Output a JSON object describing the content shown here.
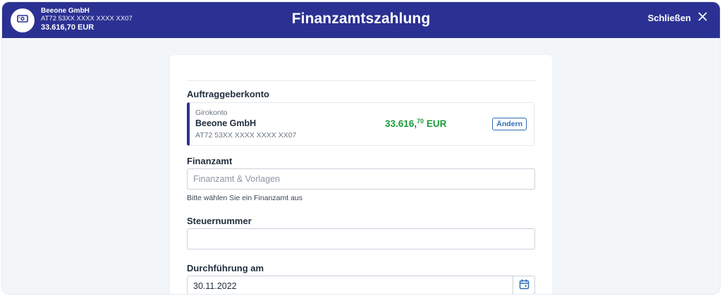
{
  "account": {
    "name": "Beeone GmbH",
    "iban": "AT72 53XX XXXX XXXX XX07",
    "balance": "33.616,70 EUR",
    "icon": "cash-icon"
  },
  "header": {
    "title": "Finanzamtszahlung",
    "close_label": "Schließen",
    "close_icon": "close-icon"
  },
  "form": {
    "source_label": "Auftraggeberkonto",
    "source": {
      "type": "Girokonto",
      "name": "Beeone GmbH",
      "iban": "AT72 53XX XXXX XXXX XX07",
      "amount_main": "33.616,",
      "amount_cents": "70",
      "amount_currency": " EUR",
      "change_label": "Ändern"
    },
    "tax_office_label": "Finanzamt",
    "tax_office_placeholder": "Finanzamt & Vorlagen",
    "tax_office_hint": "Bitte wählen Sie ein Finanzamt aus",
    "tax_number_label": "Steuernummer",
    "tax_number_value": "",
    "execution_label": "Durchführung am",
    "execution_date": "30.11.2022",
    "calendar_icon": "calendar-icon"
  },
  "colors": {
    "header_bg": "#2b3192",
    "amount_green": "#1a9b3a",
    "link_blue": "#2f6db5"
  }
}
